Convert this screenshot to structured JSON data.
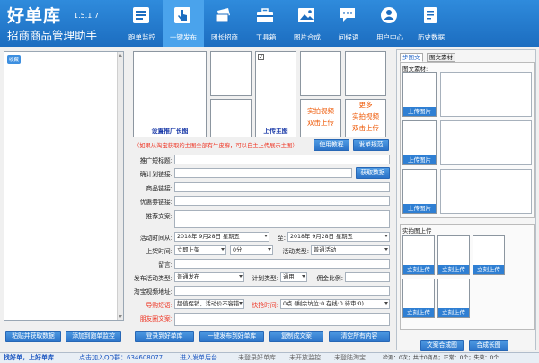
{
  "app": {
    "logo_text": "好单库",
    "version": "1.5.1.7",
    "subtitle": "招商商品管理助手"
  },
  "nav": [
    {
      "label": "跑单监控",
      "icon": "monitor-icon"
    },
    {
      "label": "一键发布",
      "icon": "hand-pointer-icon",
      "active": true
    },
    {
      "label": "团长招商",
      "icon": "ticket-icon"
    },
    {
      "label": "工具箱",
      "icon": "toolbox-icon"
    },
    {
      "label": "图片合成",
      "icon": "image-icon"
    },
    {
      "label": "问候语",
      "icon": "chat-icon"
    },
    {
      "label": "用户中心",
      "icon": "user-icon"
    },
    {
      "label": "历史数据",
      "icon": "document-icon"
    }
  ],
  "left_panel": {
    "badge": "收藏",
    "paste_button": "粘贴并获取数据",
    "add_monitor_button": "添加到跑单监控"
  },
  "images": {
    "main_image_caption": "设置推广长图",
    "main_upload_caption": "上传主图",
    "video_upload": [
      "实拍视频",
      "双击上传"
    ],
    "more_video_upload": [
      "更多",
      "实拍视频",
      "双击上传"
    ],
    "hint": "（如果从淘宝获取的主图全部有牛皮癣，可以自主上传展示主图）",
    "tutorial_button": "使用教程",
    "spec_button": "发单规范"
  },
  "form": {
    "promo_title_label": "推广短标题:",
    "plan_link_label": "确计划链接:",
    "fetch_button": "获取数据",
    "product_link_label": "商品链接:",
    "coupon_link_label": "优惠券链接:",
    "copy_label": "推荐文案:",
    "activity_time_label": "活动时间从:",
    "start_date": "2018年 9月28日 星期五",
    "to_label": "至:",
    "end_date": "2018年 9月28日 星期五",
    "listing_time_label": "上架时间:",
    "listing_time_value": "立即上架",
    "minute_value": "0分",
    "activity_type_label": "活动类型:",
    "activity_type_value": "普通活动",
    "remark_label": "留言:",
    "publish_type_label": "发布活动类型:",
    "publish_type_value": "普通发布",
    "plan_type_label": "计划类型:",
    "plan_type_value": "通用",
    "commission_label": "佣金比例:",
    "taobao_video_label": "淘宝视频地址:",
    "guide_label": "导购短语:",
    "guide_value": "超值促销，活动价不容错",
    "flash_label": "快抢时间:",
    "flash_value": "0点 (剩余坑位:0 在线:0 待审:0)",
    "moments_label": "朋友圈文案:",
    "submit_button": "登录到好单库",
    "one_click_button": "一键发布到好单库",
    "copy_button": "复制成文案",
    "clear_button": "清空所有内容"
  },
  "right_panel": {
    "tab_material": "步图文",
    "tab_material2": "图文素材",
    "section_title": "图文素材:",
    "upload_label": "上传图片",
    "live_section": "实拍图上传",
    "live_upload": "立刻上传",
    "compose_button": "文案合成图",
    "long_image_button": "合成长图"
  },
  "footer": {
    "brand": "找好单，上好单库",
    "qq_label": "点击加入QQ群：634608077",
    "backend_label": "进入发单后台",
    "status1": "未登录好单库",
    "status2": "未开放监控",
    "status3": "未登陆淘宝",
    "stats": "检测：0次；共计0商品；正常：0个；失效：0个"
  },
  "colors": {
    "header_blue": "#1c6dc0",
    "active_nav": "#4aa3ec",
    "button_blue": "#2b73c8",
    "alert_red": "#ee3322",
    "video_orange": "#ee5500"
  }
}
